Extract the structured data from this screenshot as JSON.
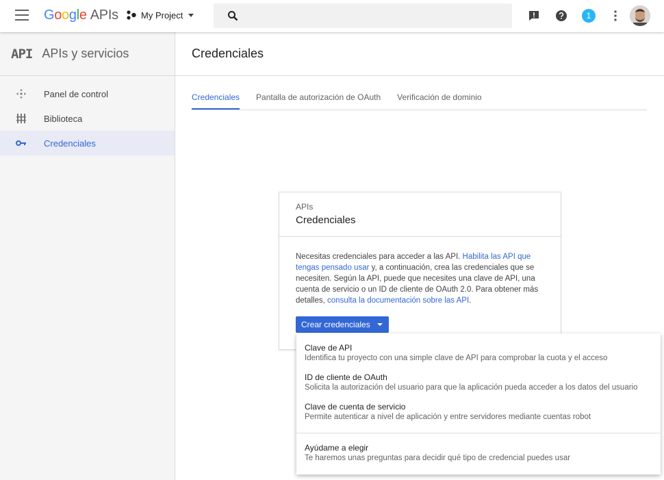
{
  "topbar": {
    "logo_google": [
      "G",
      "o",
      "o",
      "g",
      "l",
      "e"
    ],
    "logo_apis": "APIs",
    "project_name": "My Project",
    "notification_count": "1"
  },
  "sidebar": {
    "api_mark": "API",
    "title": "APIs y servicios",
    "items": [
      {
        "label": "Panel de control",
        "icon": "dashboard-icon"
      },
      {
        "label": "Biblioteca",
        "icon": "library-icon"
      },
      {
        "label": "Credenciales",
        "icon": "key-icon",
        "active": true
      }
    ]
  },
  "main": {
    "title": "Credenciales",
    "tabs": [
      {
        "label": "Credenciales",
        "active": true
      },
      {
        "label": "Pantalla de autorización de OAuth"
      },
      {
        "label": "Verificación de dominio"
      }
    ]
  },
  "card": {
    "kicker": "APIs",
    "title": "Credenciales",
    "body_1": "Necesitas credenciales para acceder a las API. ",
    "link_1": "Habilita las API que tengas pensado usar",
    "body_2": " y, a continuación, crea las credenciales que se necesiten. Según la API, puede que necesites una clave de API, una cuenta de servicio o un ID de cliente de OAuth 2.0. Para obtener más detalles, ",
    "link_2": "consulta la documentación sobre las API",
    "body_3": ".",
    "button": "Crear credenciales"
  },
  "dropdown": {
    "items": [
      {
        "title": "Clave de API",
        "desc": "Identifica tu proyecto con una simple clave de API para comprobar la cuota y el acceso"
      },
      {
        "title": "ID de cliente de OAuth",
        "desc": "Solicita la autorización del usuario para que la aplicación pueda acceder a los datos del usuario"
      },
      {
        "title": "Clave de cuenta de servicio",
        "desc": "Permite autenticar a nivel de aplicación y entre servidores mediante cuentas robot"
      },
      {
        "title": "Ayúdame a elegir",
        "desc": "Te haremos unas preguntas para decidir qué tipo de credencial puedes usar"
      }
    ]
  },
  "colors": {
    "accent": "#3367d6",
    "badge": "#29b6f6",
    "active_bg": "#e8eaf6"
  }
}
